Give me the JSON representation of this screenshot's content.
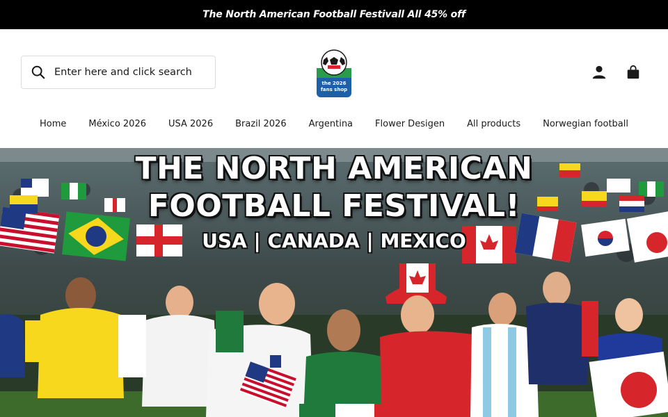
{
  "announcement": {
    "text": "The North American Football Festivall All 45% off"
  },
  "search": {
    "placeholder": "Enter here and click search"
  },
  "logo": {
    "line1": "the 2026",
    "line2": "fans shop"
  },
  "nav": {
    "items": [
      {
        "label": "Home"
      },
      {
        "label": "México 2026"
      },
      {
        "label": "USA 2026"
      },
      {
        "label": "Brazil 2026"
      },
      {
        "label": "Argentina"
      },
      {
        "label": "Flower Desigen"
      },
      {
        "label": "All products"
      },
      {
        "label": "Norwegian football"
      }
    ]
  },
  "icons": {
    "search": "search-icon",
    "account": "user-icon",
    "cart": "shopping-bag-icon"
  },
  "hero": {
    "title_line1": "THE NORTH AMERICAN",
    "title_line2": "FOOTBALL FESTIVAL!",
    "subtitle": "USA | CANADA | MEXICO"
  },
  "colors": {
    "announce_bg": "#000000",
    "text": "#1a1a1a",
    "border": "#dcdcdc"
  }
}
